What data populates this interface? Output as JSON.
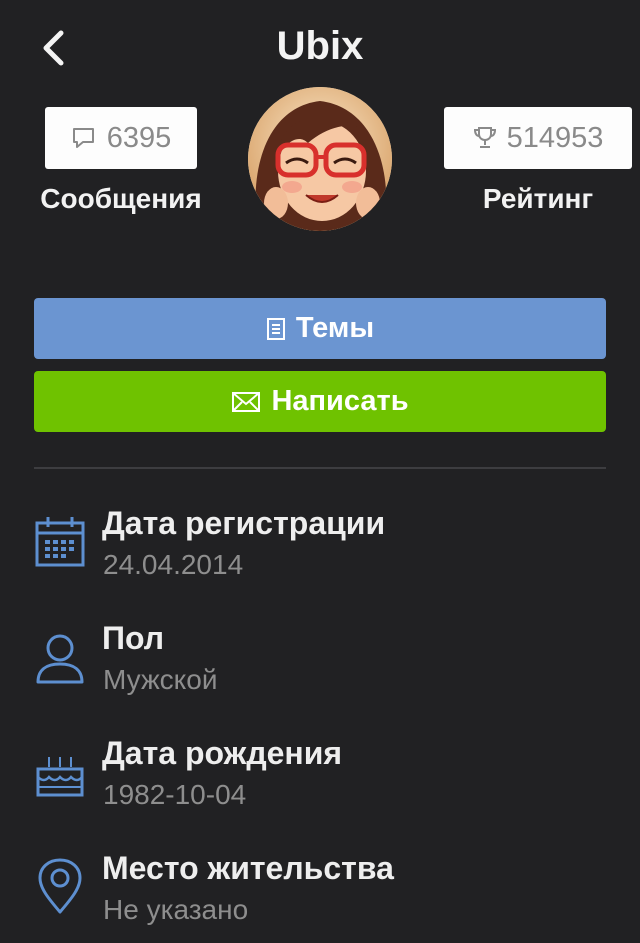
{
  "header": {
    "title": "Ubix"
  },
  "stats": {
    "messages_count": "6395",
    "messages_label": "Сообщения",
    "rating_count": "514953",
    "rating_label": "Рейтинг"
  },
  "actions": {
    "topics_label": "Темы",
    "write_label": "Написать"
  },
  "info": {
    "registration_label": "Дата регистрации",
    "registration_value": "24.04.2014",
    "gender_label": "Пол",
    "gender_value": "Мужской",
    "birthday_label": "Дата рождения",
    "birthday_value": "1982-10-04",
    "residence_label": "Место жительства",
    "residence_value": "Не указано"
  },
  "icons": {
    "back": "chevron-left-icon",
    "messages": "speech-bubble-icon",
    "rating": "trophy-icon",
    "topics": "document-icon",
    "write": "envelope-icon",
    "registration": "calendar-icon",
    "gender": "person-icon",
    "birthday": "cake-icon",
    "residence": "map-pin-icon"
  },
  "colors": {
    "background": "#212123",
    "topics_button": "#6b95d1",
    "write_button": "#6fc200",
    "icon_accent": "#5d8fd0"
  }
}
